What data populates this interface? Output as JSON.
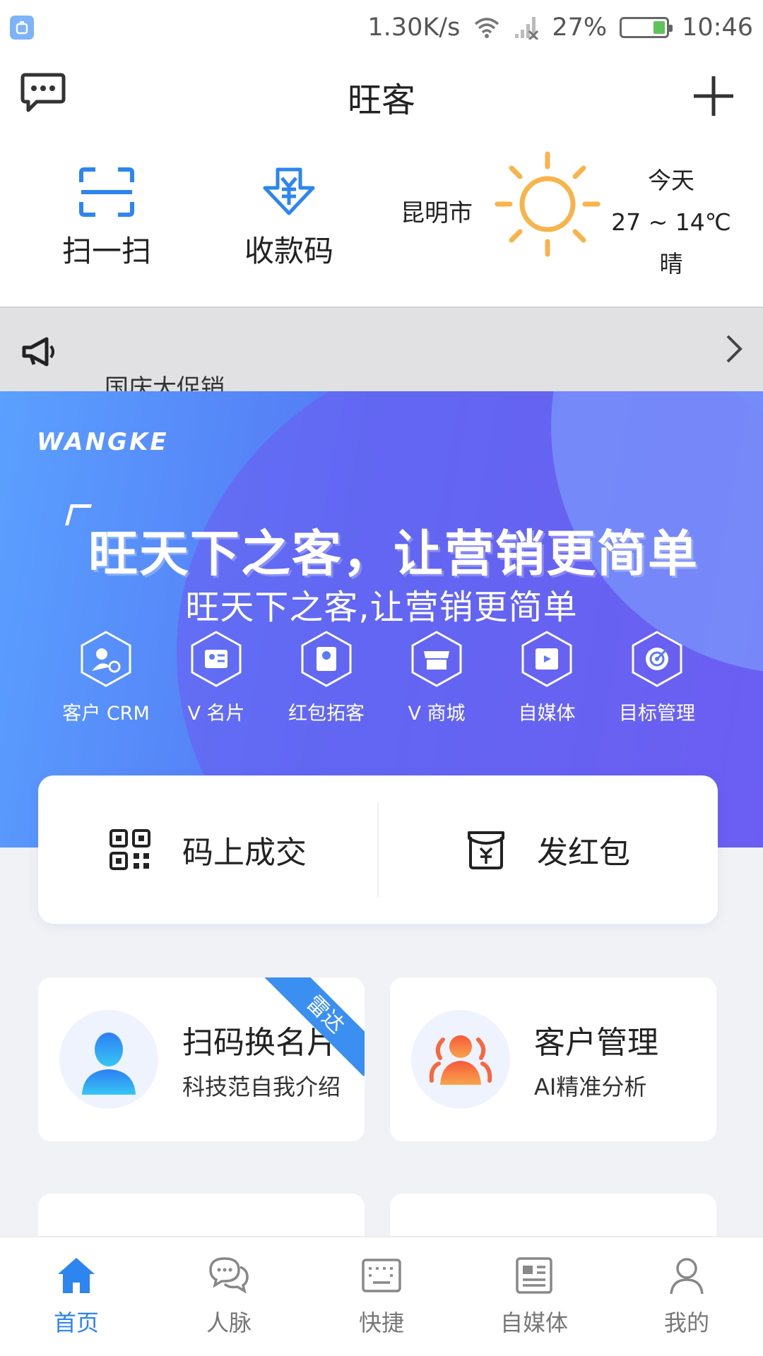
{
  "status_bar": {
    "speed": "1.30K/s",
    "battery": "27%",
    "battery_level": 0.27,
    "time": "10:46"
  },
  "header": {
    "title": "旺客",
    "left_icon": "chat-bubble-icon",
    "right_icon": "plus-icon"
  },
  "quick_tools": [
    {
      "label": "扫一扫",
      "icon": "scan-icon"
    },
    {
      "label": "收款码",
      "icon": "yuan-download-icon"
    }
  ],
  "weather": {
    "city": "昆明市",
    "day": "今天",
    "temp": "27 ~ 14℃",
    "condition": "晴",
    "icon": "sun-icon"
  },
  "notice": {
    "text": "国庆大促销",
    "icon": "megaphone-icon"
  },
  "banner": {
    "brand": "WANGKE",
    "slogan_big": "旺天下之客，让营销更简单",
    "slogan_small": "旺天下之客,让营销更简单",
    "features": [
      {
        "label": "客户 CRM",
        "icon": "crm-icon"
      },
      {
        "label": "V 名片",
        "icon": "card-icon"
      },
      {
        "label": "红包拓客",
        "icon": "red-packet-icon"
      },
      {
        "label": "V 商城",
        "icon": "shop-icon"
      },
      {
        "label": "自媒体",
        "icon": "video-icon"
      },
      {
        "label": "目标管理",
        "icon": "target-icon"
      }
    ]
  },
  "actions": [
    {
      "label": "码上成交",
      "icon": "qr-code-icon"
    },
    {
      "label": "发红包",
      "icon": "red-envelope-icon"
    }
  ],
  "cards": [
    {
      "title": "扫码换名片",
      "subtitle": "科技范自我介绍",
      "ribbon": "雷达",
      "icon": "person-avatar-icon"
    },
    {
      "title": "客户管理",
      "subtitle": "AI精准分析",
      "icon": "group-icon"
    }
  ],
  "bottom_nav": [
    {
      "label": "首页",
      "icon": "home-icon",
      "active": true
    },
    {
      "label": "人脉",
      "icon": "chat-icon",
      "active": false
    },
    {
      "label": "快捷",
      "icon": "keyboard-icon",
      "active": false
    },
    {
      "label": "自媒体",
      "icon": "news-icon",
      "active": false
    },
    {
      "label": "我的",
      "icon": "user-icon",
      "active": false
    }
  ]
}
